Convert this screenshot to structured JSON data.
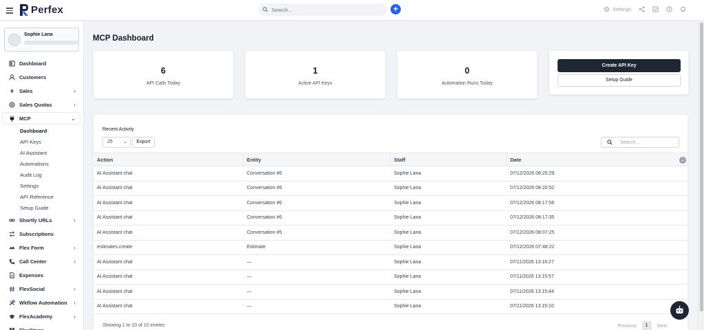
{
  "app": {
    "name": "Perfex"
  },
  "topbar": {
    "search_placeholder": "Search...",
    "settings_label": "Settings"
  },
  "profile": {
    "name": "Sophie Lana"
  },
  "sidebar": {
    "items": [
      {
        "label": "Dashboard",
        "icon": "dashboard-icon",
        "chevron": ""
      },
      {
        "label": "Customers",
        "icon": "user-icon",
        "chevron": ""
      },
      {
        "label": "Sales",
        "icon": "bolt-icon",
        "chevron": "‹"
      },
      {
        "label": "Sales Quotas",
        "icon": "target-icon",
        "chevron": "‹"
      },
      {
        "label": "MCP",
        "icon": "plug-icon",
        "chevron": "⌄"
      }
    ],
    "mcp_sub": [
      "Dashboard",
      "API Keys",
      "AI Assistant",
      "Automations",
      "Audit Log",
      "Settings",
      "API Reference",
      "Setup Guide"
    ],
    "items_after": [
      {
        "label": "Shortly URLs",
        "icon": "link-icon",
        "chevron": "‹"
      },
      {
        "label": "Subscriptions",
        "icon": "repeat-icon",
        "chevron": ""
      },
      {
        "label": "Flex Form",
        "icon": "form-icon",
        "chevron": "‹"
      },
      {
        "label": "Call Center",
        "icon": "phone-icon",
        "chevron": "‹"
      },
      {
        "label": "Expenses",
        "icon": "file-icon",
        "chevron": ""
      },
      {
        "label": "FlexSocial",
        "icon": "hash-icon",
        "chevron": "‹"
      },
      {
        "label": "Wkflow Automation",
        "icon": "tools-icon",
        "chevron": "‹"
      },
      {
        "label": "FlexAcademy",
        "icon": "graduation-icon",
        "chevron": "‹"
      },
      {
        "label": "FlexStage",
        "icon": "grid-icon",
        "chevron": ""
      }
    ]
  },
  "main": {
    "title": "MCP Dashboard",
    "stats": [
      {
        "value": "6",
        "label": "API Calls Today"
      },
      {
        "value": "1",
        "label": "Active API Keys"
      },
      {
        "value": "0",
        "label": "Automation Runs Today"
      }
    ],
    "create_api_key": "Create API Key",
    "setup_guide": "Setup Guide"
  },
  "activity": {
    "title": "Recent Activity",
    "page_size": "25",
    "export_label": "Export",
    "search_placeholder": "Search...",
    "columns": [
      "Action",
      "Entity",
      "Staff",
      "Date"
    ],
    "rows": [
      [
        "AI Assistant chat",
        "Conversation #6",
        "Sophie Lana",
        "07/12/2026 08:25:29"
      ],
      [
        "AI Assistant chat",
        "Conversation #6",
        "Sophie Lana",
        "07/12/2026 08:20:52"
      ],
      [
        "AI Assistant chat",
        "Conversation #6",
        "Sophie Lana",
        "07/12/2026 08:17:56"
      ],
      [
        "AI Assistant chat",
        "Conversation #6",
        "Sophie Lana",
        "07/12/2026 08:17:35"
      ],
      [
        "AI Assistant chat",
        "Conversation #5",
        "Sophie Lana",
        "07/12/2026 08:07:25"
      ],
      [
        "estimates.create",
        "Estimate",
        "Sophie Lana",
        "07/12/2026 07:48:22"
      ],
      [
        "AI Assistant chat",
        "—",
        "Sophie Lana",
        "07/11/2026 13:16:27"
      ],
      [
        "AI Assistant chat",
        "—",
        "Sophie Lana",
        "07/11/2026 13:15:57"
      ],
      [
        "AI Assistant chat",
        "—",
        "Sophie Lana",
        "07/11/2026 13:15:44"
      ],
      [
        "AI Assistant chat",
        "—",
        "Sophie Lana",
        "07/11/2026 13:15:10"
      ]
    ],
    "footer_info": "Showing 1 to 10 of 10 entries",
    "prev_label": "Previous",
    "current_page": "1",
    "next_label": "Next"
  },
  "colors": {
    "accent": "#2563eb",
    "dark_button": "#1e2533"
  }
}
